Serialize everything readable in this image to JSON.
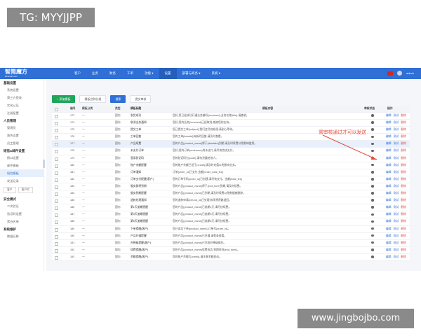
{
  "watermarks": {
    "top": "TG: MYYJJPP",
    "bottom": "www.jingbojbo.com"
  },
  "app": {
    "logo": {
      "name": "智简魔方",
      "sub": "idcsmart.com"
    },
    "nav": [
      "客户",
      "业务",
      "财务",
      "工单",
      "功能 ▾",
      "设置",
      "部署与商务 ▾",
      "系统 ▾"
    ],
    "user": "admin"
  },
  "sidebar": {
    "groups": [
      {
        "title": "基础设置",
        "items": [
          "系统设置",
          "第三方登录",
          "实名认证",
          "注册配置"
        ]
      },
      {
        "title": "人员管理",
        "items": [
          "管理员",
          "角色设置",
          "员工管理"
        ]
      },
      {
        "title": "短信&邮件设置",
        "items": [
          "接口设置",
          "邮件模板",
          "短信模板",
          "发送记录"
        ]
      },
      {
        "title": "安全模式",
        "items": [
          "二次验证",
          "验证码设置",
          "黑白名单"
        ]
      },
      {
        "title": "系统维护",
        "items": [
          "数据迁移"
        ]
      }
    ],
    "active": "短信模板",
    "tabs": [
      "客户",
      "客户栏"
    ]
  },
  "toolbar": {
    "add": "+ 添加模板",
    "b2": "模板名称分组",
    "b3": "搜索",
    "b4": "提交审核"
  },
  "table": {
    "headers": {
      "id": "编号",
      "cat": "模板分类",
      "type": "类型",
      "name": "模板标题",
      "content": "模板内容",
      "status": "审核状态",
      "ops": "操作"
    },
    "ops": {
      "edit": "编辑",
      "test": "测试",
      "del": "删除"
    },
    "rows": [
      {
        "id": "173",
        "cat": "一",
        "type": "国内",
        "name": "发货成功",
        "content": "您好,您已经成功开通业务编号{invoiceid},业务名称{title},请查收。",
        "ok": false
      },
      {
        "id": "174",
        "cat": "一",
        "type": "国内",
        "name": "取消业务通知",
        "content": "您好,您的业务{invoiceid}已经取消,感谢您的支持。",
        "ok": false
      },
      {
        "id": "175",
        "cat": "一",
        "type": "国内",
        "name": "提交工单",
        "content": "您已提交工单{subject},我们会尽快处理,请耐心等待。",
        "ok": false
      },
      {
        "id": "176",
        "cat": "一",
        "type": "国内",
        "name": "工单回复",
        "content": "您的工单{ticketid}有新的回复,请及时查看。",
        "ok": false
      },
      {
        "id": "177",
        "cat": "一",
        "type": "国内",
        "name": "产品续费",
        "content": "您的产品{product_name}将于{duedate}到期,请及时续费以免影响使用。",
        "ok": false,
        "hl": true
      },
      {
        "id": "178",
        "cat": "一",
        "type": "国内",
        "name": "未支付订单",
        "content": "您好,您的订单{ordernum}尚未支付,请尽快完成支付。",
        "ok": false
      },
      {
        "id": "179",
        "cat": "一",
        "type": "国内",
        "name": "登录验证码",
        "content": "您的验证码为{code},请勿泄露给他人。",
        "ok": true
      },
      {
        "id": "180",
        "cat": "一",
        "type": "国内",
        "name": "账户余额提醒",
        "content": "您的账户余额已低于{credit},请及时充值以免影响业务。",
        "ok": false
      },
      {
        "id": "181",
        "cat": "一",
        "type": "国内",
        "name": "订单通知",
        "content": "订单{order_id}已支付,金额{order_total_fee}",
        "ok": false
      },
      {
        "id": "182",
        "cat": "一",
        "type": "国内",
        "name": "订单支付提醒(客户)",
        "content": "您的订单号码{order_id}已创建,请尽快支付。金额{total_fee}",
        "ok": false
      },
      {
        "id": "183",
        "cat": "一",
        "type": "国内",
        "name": "服务即将到期",
        "content": "您的产品{product_name}将于{end_time}到期,请及时续费。",
        "ok": false
      },
      {
        "id": "184",
        "cat": "一",
        "type": "国内",
        "name": "服务到期提醒",
        "content": "您的产品{product_name}已到期,请及时续费以免数据被删除。",
        "ok": false
      },
      {
        "id": "185",
        "cat": "一",
        "type": "国内",
        "name": "退款处理通知",
        "content": "您的退款申请{refund_id}已处理,款项将原路退回。",
        "ok": false
      },
      {
        "id": "186",
        "cat": "一",
        "type": "国内",
        "name": "第1天逾期提醒",
        "content": "您的产品{product_name}已逾期1天,请尽快续费。",
        "ok": false
      },
      {
        "id": "187",
        "cat": "一",
        "type": "国内",
        "name": "第3天逾期提醒",
        "content": "您的产品{product_name}已逾期3天,请尽快续费。",
        "ok": false
      },
      {
        "id": "188",
        "cat": "一",
        "type": "国内",
        "name": "第5天逾期提醒",
        "content": "您的产品{product_name}已逾期5天,请尽快续费。",
        "ok": false
      },
      {
        "id": "189",
        "cat": "一",
        "type": "国内",
        "name": "下单提醒(客户)",
        "content": "您已成功下单{product_name},订单号{order_id}。",
        "ok": false
      },
      {
        "id": "190",
        "cat": "一",
        "type": "国内",
        "name": "产品开通提醒",
        "content": "您的产品{product_name}已开通,请登录查看。",
        "ok": false
      },
      {
        "id": "191",
        "cat": "一",
        "type": "国内",
        "name": "升降级提醒(客户)",
        "content": "您的产品{product_name}已完成升降级操作。",
        "ok": false
      },
      {
        "id": "192",
        "cat": "一",
        "type": "国内",
        "name": "续费提醒(客户)",
        "content": "您的产品{product_name}续费成功,到期时间{end_time}。",
        "ok": false
      },
      {
        "id": "193",
        "cat": "一",
        "type": "国内",
        "name": "余额提醒(客户)",
        "content": "您的账户余额为{credit},请注意余额变动。",
        "ok": false
      }
    ]
  },
  "callout": "需审核通过才可以发送",
  "colors": {
    "nav": "#2f6fd6",
    "green": "#1fa65a",
    "callout": "#e24c3c"
  }
}
